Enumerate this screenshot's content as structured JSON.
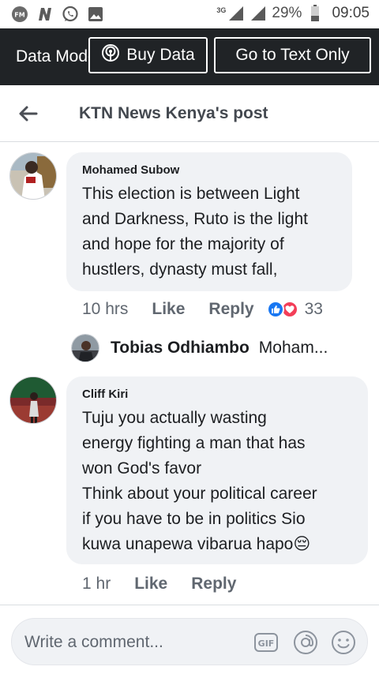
{
  "status_bar": {
    "network": "3G",
    "battery": "29%",
    "time": "09:05"
  },
  "data_banner": {
    "label": "Data Mode",
    "buy_label": "Buy Data",
    "text_only_label": "Go to Text Only"
  },
  "header": {
    "title": "KTN News Kenya's post"
  },
  "comments": [
    {
      "author": "Mohamed Subow",
      "text": "This election is between Light\nand Darkness, Ruto is the light\nand hope for the majority of\nhustlers, dynasty must fall,",
      "time": "10 hrs",
      "like": "Like",
      "reply": "Reply",
      "reactions": "33"
    },
    {
      "author": "Cliff Kiri",
      "text": "Tuju  you actually wasting\nenergy fighting a man that has\nwon God's favor\nThink about your political career\nif you have to be in politics Sio\nkuwa unapewa vibarua hapo😔",
      "time": "1 hr",
      "like": "Like",
      "reply": "Reply"
    }
  ],
  "reply_preview": {
    "author": "Tobias Odhiambo",
    "snippet": "Moham..."
  },
  "composer": {
    "placeholder": "Write a comment...",
    "gif_label": "GIF"
  },
  "colors": {
    "banner_bg": "#202326",
    "bubble_bg": "#f0f2f5",
    "like_blue": "#1877f2",
    "love_red": "#f33e58"
  }
}
